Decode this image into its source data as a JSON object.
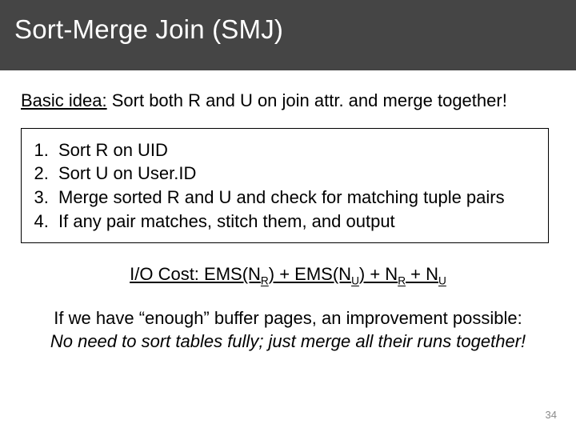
{
  "title": "Sort-Merge Join (SMJ)",
  "basic": {
    "label": "Basic idea:",
    "text": " Sort both R and U on join attr. and merge together!"
  },
  "steps": [
    "Sort R on UID",
    "Sort U on User.ID",
    "Merge sorted R and U and check for matching tuple pairs",
    "If any pair matches, stitch them, and output"
  ],
  "cost": {
    "label": "I/O Cost:",
    "pre": " EMS(N",
    "subR": "R",
    "mid1": ") + EMS(N",
    "subU": "U",
    "mid2": ") + N",
    "subR2": "R",
    "mid3": " + N",
    "subU2": "U"
  },
  "improve": {
    "line1": "If we have “enough” buffer pages, an improvement possible:",
    "line2": "No need to sort tables fully; just merge all their runs together!"
  },
  "page_number": "34"
}
